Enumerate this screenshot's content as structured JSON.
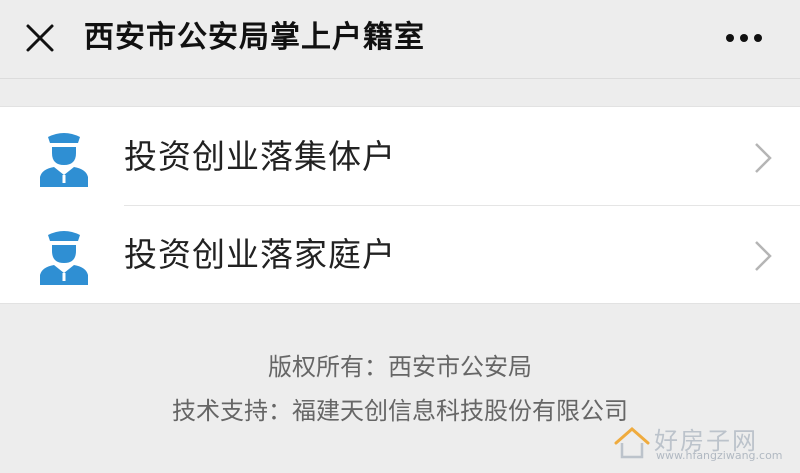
{
  "header": {
    "title": "西安市公安局掌上户籍室",
    "close_icon": "close-icon",
    "more_icon": "more-icon"
  },
  "menu": {
    "items": [
      {
        "label": "投资创业落集体户",
        "icon": "police-officer-icon"
      },
      {
        "label": "投资创业落家庭户",
        "icon": "police-officer-icon"
      }
    ]
  },
  "footer": {
    "copyright": "版权所有：西安市公安局",
    "support": "技术支持：福建天创信息科技股份有限公司"
  },
  "watermark": {
    "text": "好房子网",
    "url": "www.hfangziwang.com"
  },
  "colors": {
    "icon_blue": "#2f8fd3",
    "background": "#ededed"
  }
}
